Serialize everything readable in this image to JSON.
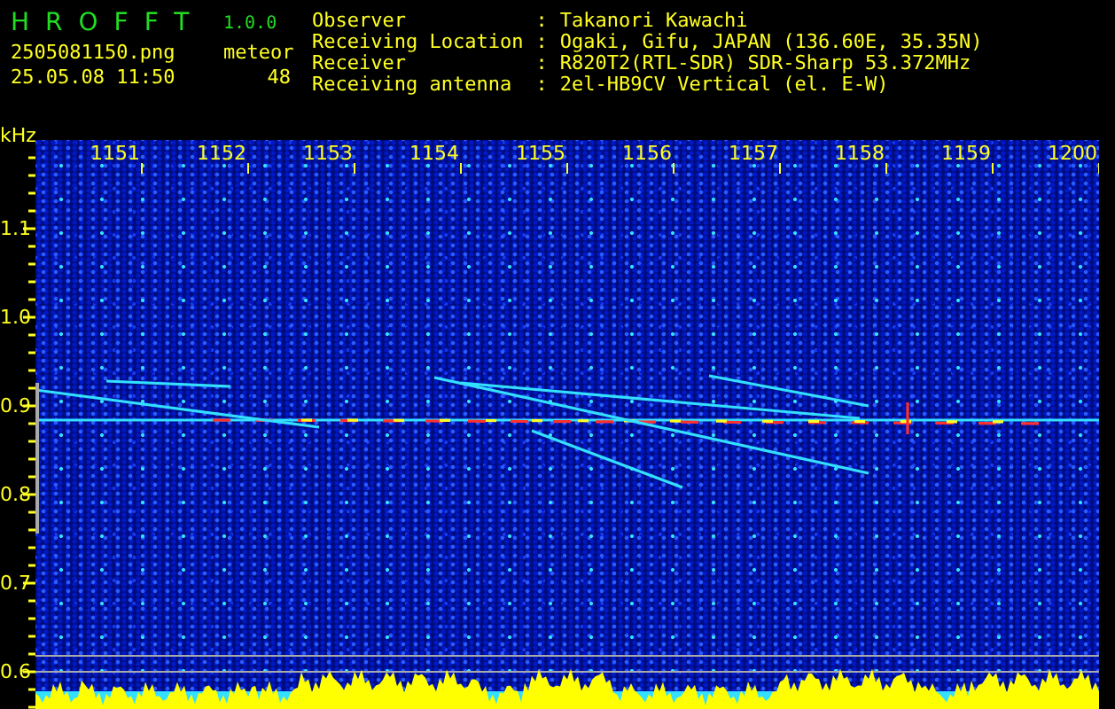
{
  "app": {
    "name": "HROFFT",
    "version": "1.0.0"
  },
  "capture": {
    "file": "2505081150.png",
    "datetime": "25.05.08 11:50",
    "meteor_label": "meteor",
    "meteor_count": "48"
  },
  "info": [
    {
      "label": "Observer",
      "sep": ":",
      "value": "Takanori Kawachi"
    },
    {
      "label": "Receiving Location",
      "sep": ":",
      "value": "Ogaki, Gifu, JAPAN (136.60E, 35.35N)"
    },
    {
      "label": "Receiver",
      "sep": ":",
      "value": "R820T2(RTL-SDR) SDR-Sharp 53.372MHz"
    },
    {
      "label": "Receiving antenna",
      "sep": ":",
      "value": "2el-HB9CV Vertical (el. E-W)"
    }
  ],
  "spectrogram": {
    "unit": "kHz",
    "time_labels": [
      "1151",
      "1152",
      "1153",
      "1154",
      "1155",
      "1156",
      "1157",
      "1158",
      "1159",
      "1200"
    ],
    "freq_labels": [
      "1.1",
      "1.0",
      "0.9",
      "0.8",
      "0.7",
      "0.6"
    ]
  }
}
